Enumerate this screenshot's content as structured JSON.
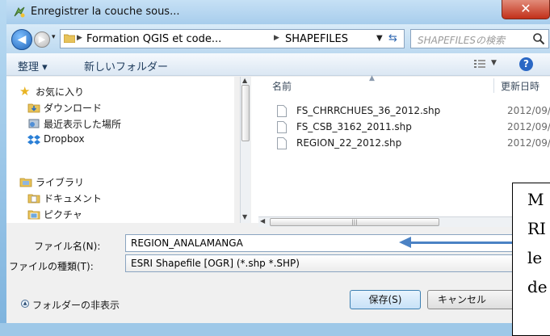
{
  "window": {
    "title": "Enregistrer la couche sous...",
    "close_glyph": "✕"
  },
  "nav": {
    "breadcrumb": [
      "Formation QGIS et code...",
      "SHAPEFILES"
    ],
    "search_placeholder": "SHAPEFILESの検索"
  },
  "toolbar": {
    "organize": "整理 ▾",
    "new_folder": "新しいフォルダー",
    "help": "?"
  },
  "sidebar": {
    "favorites_header": "お気に入り",
    "favorites": [
      "ダウンロード",
      "最近表示した場所",
      "Dropbox"
    ],
    "libraries_header": "ライブラリ",
    "libraries": [
      "ドキュメント",
      "ピクチャ"
    ]
  },
  "columns": {
    "name": "名前",
    "date": "更新日時"
  },
  "files": [
    {
      "name": "FS_CHRRCHUES_36_2012.shp",
      "date": "2012/09/"
    },
    {
      "name": "FS_CSB_3162_2011.shp",
      "date": "2012/09/"
    },
    {
      "name": "REGION_22_2012.shp",
      "date": "2012/09/"
    }
  ],
  "form": {
    "filename_label": "ファイル名(N):",
    "filename_value": "REGION_ANALAMANGA",
    "filetype_label": "ファイルの種類(T):",
    "filetype_value": "ESRI Shapefile [OGR] (*.shp *.SHP)"
  },
  "footer": {
    "hide_folders": "フォルダーの非表示",
    "save": "保存(S)",
    "cancel": "キャンセル"
  },
  "annotation": {
    "lines": [
      "M",
      "RI",
      "le",
      "de"
    ]
  },
  "colors": {
    "title_bg": "#b4d4f0",
    "close_red": "#c2301a",
    "arrow_blue": "#4b82c4"
  }
}
